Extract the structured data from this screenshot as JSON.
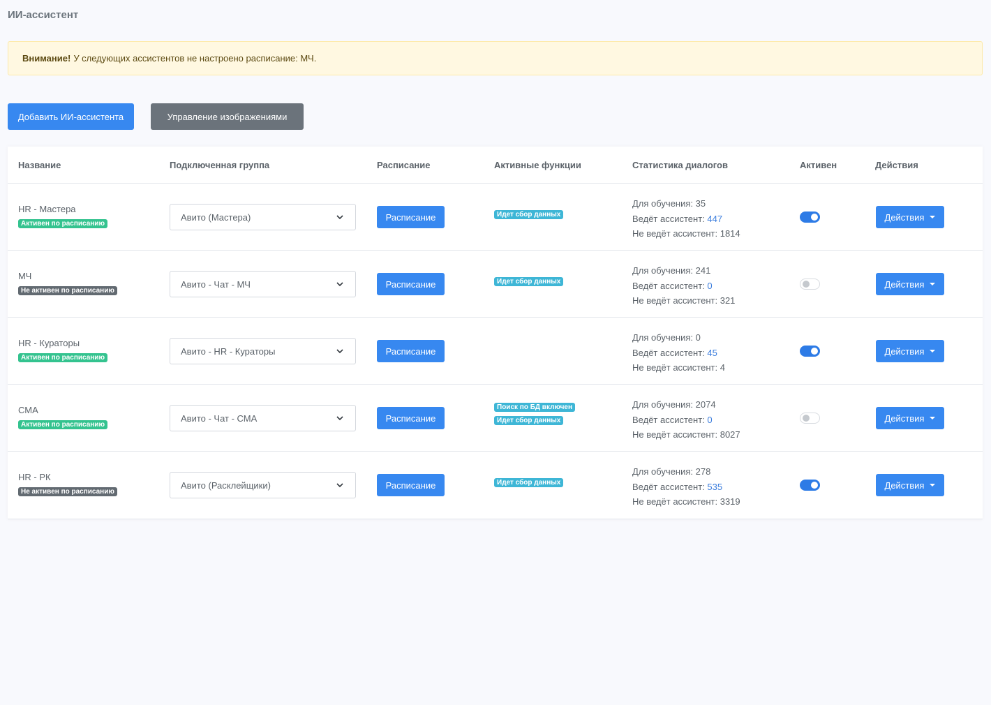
{
  "page": {
    "title": "ИИ-ассистент"
  },
  "alert": {
    "strong": "Внимание!",
    "text": "У следующих ассистентов не настроено расписание: МЧ."
  },
  "toolbar": {
    "add_label": "Добавить ИИ-ассистента",
    "images_label": "Управление изображениями"
  },
  "table": {
    "headers": {
      "name": "Название",
      "group": "Подключенная группа",
      "schedule": "Расписание",
      "functions": "Активные функции",
      "stats": "Статистика диалогов",
      "active": "Активен",
      "actions": "Действия"
    },
    "stat_labels": {
      "training": "Для обучения:",
      "handled": "Ведёт ассистент:",
      "not_handled": "Не ведёт ассистент:"
    },
    "schedule_button": "Расписание",
    "actions_button": "Действия",
    "rows": [
      {
        "name": "HR - Мастера",
        "status": "Активен по расписанию",
        "status_active": true,
        "group": "Авито (Мастера)",
        "functions": [
          "Идет сбор данных"
        ],
        "training": "35",
        "handled": "447",
        "not_handled": "1814",
        "active": true
      },
      {
        "name": "МЧ",
        "status": "Не активен по расписанию",
        "status_active": false,
        "group": "Авито - Чат - МЧ",
        "functions": [
          "Идет сбор данных"
        ],
        "training": "241",
        "handled": "0",
        "not_handled": "321",
        "active": false
      },
      {
        "name": "HR - Кураторы",
        "status": "Активен по расписанию",
        "status_active": true,
        "group": "Авито - HR - Кураторы",
        "functions": [],
        "training": "0",
        "handled": "45",
        "not_handled": "4",
        "active": true
      },
      {
        "name": "СМА",
        "status": "Активен по расписанию",
        "status_active": true,
        "group": "Авито - Чат - СМА",
        "functions": [
          "Поиск по БД включен",
          "Идет сбор данных"
        ],
        "training": "2074",
        "handled": "0",
        "not_handled": "8027",
        "active": false
      },
      {
        "name": "HR - РК",
        "status": "Не активен по расписанию",
        "status_active": false,
        "group": "Авито (Расклейщики)",
        "functions": [
          "Идет сбор данных"
        ],
        "training": "278",
        "handled": "535",
        "not_handled": "3319",
        "active": true
      }
    ]
  },
  "icons": {
    "select_chevron": "chevron-down-icon",
    "dropdown_caret": "caret-down-icon"
  },
  "colors": {
    "primary": "#3788f0",
    "secondary": "#6b737b",
    "badge_active": "#34c38f",
    "badge_inactive": "#626a71",
    "badge_info": "#3eb6d6",
    "link_value": "#3b7ddd",
    "alert_bg": "#fff8e1"
  }
}
